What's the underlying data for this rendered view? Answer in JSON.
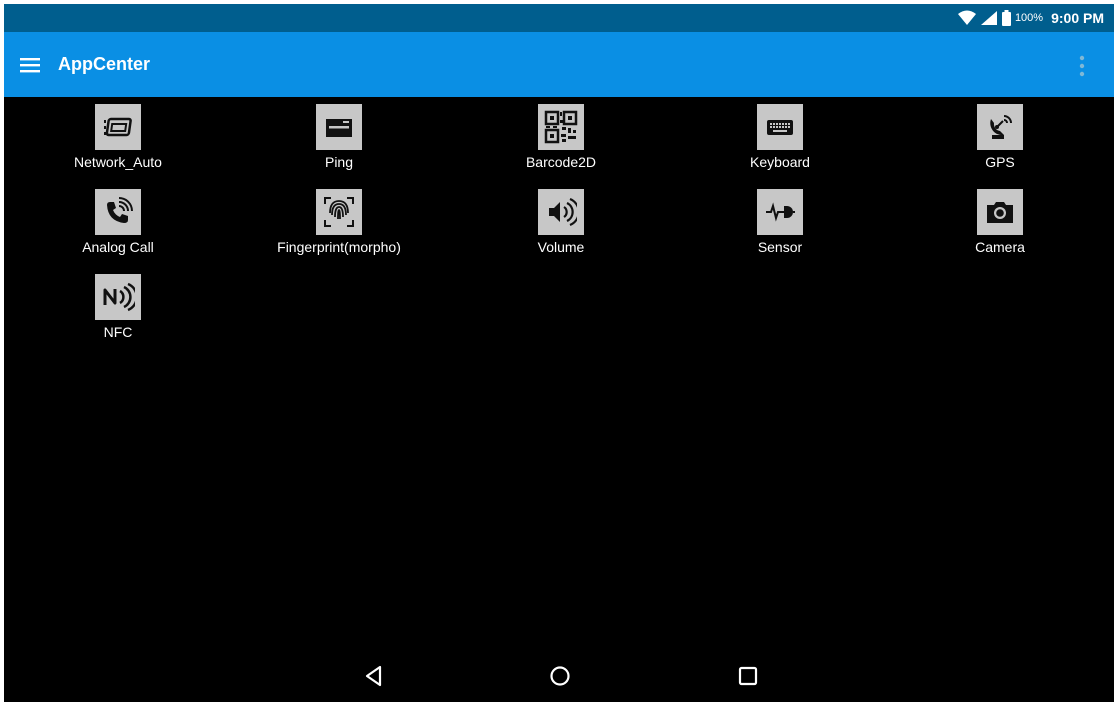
{
  "status_bar": {
    "battery_percent": "100%",
    "time": "9:00 PM"
  },
  "app_bar": {
    "title": "AppCenter"
  },
  "apps": [
    {
      "label": "Network_Auto",
      "icon": "network-auto-icon"
    },
    {
      "label": "Ping",
      "icon": "ping-icon"
    },
    {
      "label": "Barcode2D",
      "icon": "qr-code-icon"
    },
    {
      "label": "Keyboard",
      "icon": "keyboard-icon"
    },
    {
      "label": "GPS",
      "icon": "gps-satellite-icon"
    },
    {
      "label": "Analog Call",
      "icon": "phone-call-icon"
    },
    {
      "label": "Fingerprint(morpho)",
      "icon": "fingerprint-icon"
    },
    {
      "label": "Volume",
      "icon": "volume-icon"
    },
    {
      "label": "Sensor",
      "icon": "sensor-icon"
    },
    {
      "label": "Camera",
      "icon": "camera-icon"
    },
    {
      "label": "NFC",
      "icon": "nfc-icon"
    }
  ],
  "colors": {
    "status_bar": "#005e8e",
    "app_bar": "#0a8fe4",
    "background": "#000000",
    "icon_tile": "#c7c7c7"
  }
}
